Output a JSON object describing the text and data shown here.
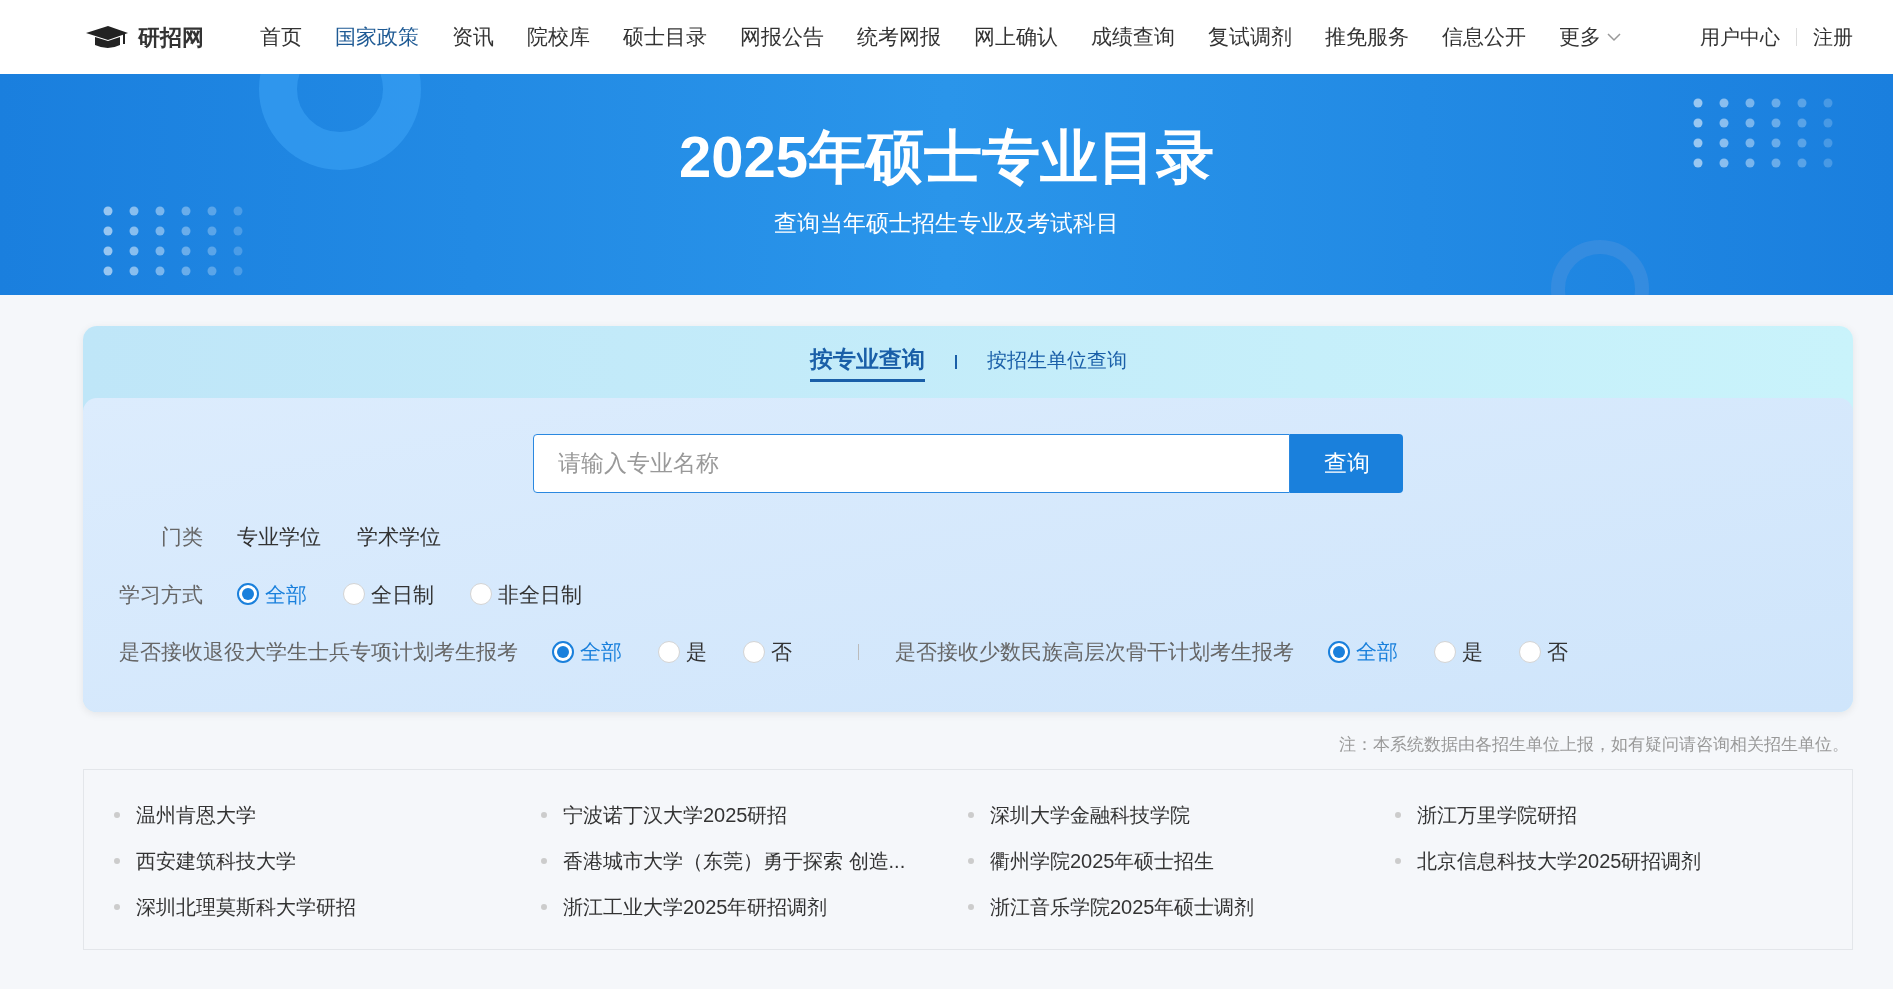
{
  "nav": {
    "logo": "研招网",
    "items": [
      {
        "label": "首页",
        "selected": false
      },
      {
        "label": "国家政策",
        "selected": true
      },
      {
        "label": "资讯",
        "selected": false
      },
      {
        "label": "院校库",
        "selected": false
      },
      {
        "label": "硕士目录",
        "selected": false
      },
      {
        "label": "网报公告",
        "selected": false
      },
      {
        "label": "统考网报",
        "selected": false
      },
      {
        "label": "网上确认",
        "selected": false
      },
      {
        "label": "成绩查询",
        "selected": false
      },
      {
        "label": "复试调剂",
        "selected": false
      },
      {
        "label": "推免服务",
        "selected": false
      },
      {
        "label": "信息公开",
        "selected": false
      }
    ],
    "more": "更多",
    "user_links": [
      "用户中心",
      "注册"
    ]
  },
  "banner": {
    "title": "2025年硕士专业目录",
    "subtitle": "查询当年硕士招生专业及考试科目"
  },
  "search_tabs": [
    {
      "label": "按专业查询",
      "selected": true
    },
    {
      "label": "按招生单位查询",
      "selected": false
    }
  ],
  "search": {
    "placeholder": "请输入专业名称",
    "button": "查询"
  },
  "filter_rows": [
    {
      "groups": [
        {
          "label": "门类",
          "kind": "plain",
          "options": [
            {
              "label": "专业学位"
            },
            {
              "label": "学术学位"
            }
          ]
        }
      ]
    },
    {
      "groups": [
        {
          "label": "学习方式",
          "kind": "radio",
          "options": [
            {
              "label": "全部",
              "selected": true
            },
            {
              "label": "全日制",
              "selected": false
            },
            {
              "label": "非全日制",
              "selected": false
            }
          ]
        }
      ]
    },
    {
      "groups": [
        {
          "label": "是否接收退役大学生士兵专项计划考生报考",
          "kind": "radio",
          "options": [
            {
              "label": "全部",
              "selected": true
            },
            {
              "label": "是",
              "selected": false
            },
            {
              "label": "否",
              "selected": false
            }
          ]
        },
        {
          "label": "是否接收少数民族高层次骨干计划考生报考",
          "kind": "radio",
          "options": [
            {
              "label": "全部",
              "selected": true
            },
            {
              "label": "是",
              "selected": false
            },
            {
              "label": "否",
              "selected": false
            }
          ]
        }
      ]
    }
  ],
  "note": "注：本系统数据由各招生单位上报，如有疑问请咨询相关招生单位。",
  "links": [
    "温州肯恩大学",
    "宁波诺丁汉大学2025研招",
    "深圳大学金融科技学院",
    "浙江万里学院研招",
    "西安建筑科技大学",
    "香港城市大学（东莞）勇于探索 创造...",
    "衢州学院2025年硕士招生",
    "北京信息科技大学2025研招调剂",
    "深圳北理莫斯科大学研招",
    "浙江工业大学2025年研招调剂",
    "浙江音乐学院2025年硕士调剂"
  ]
}
